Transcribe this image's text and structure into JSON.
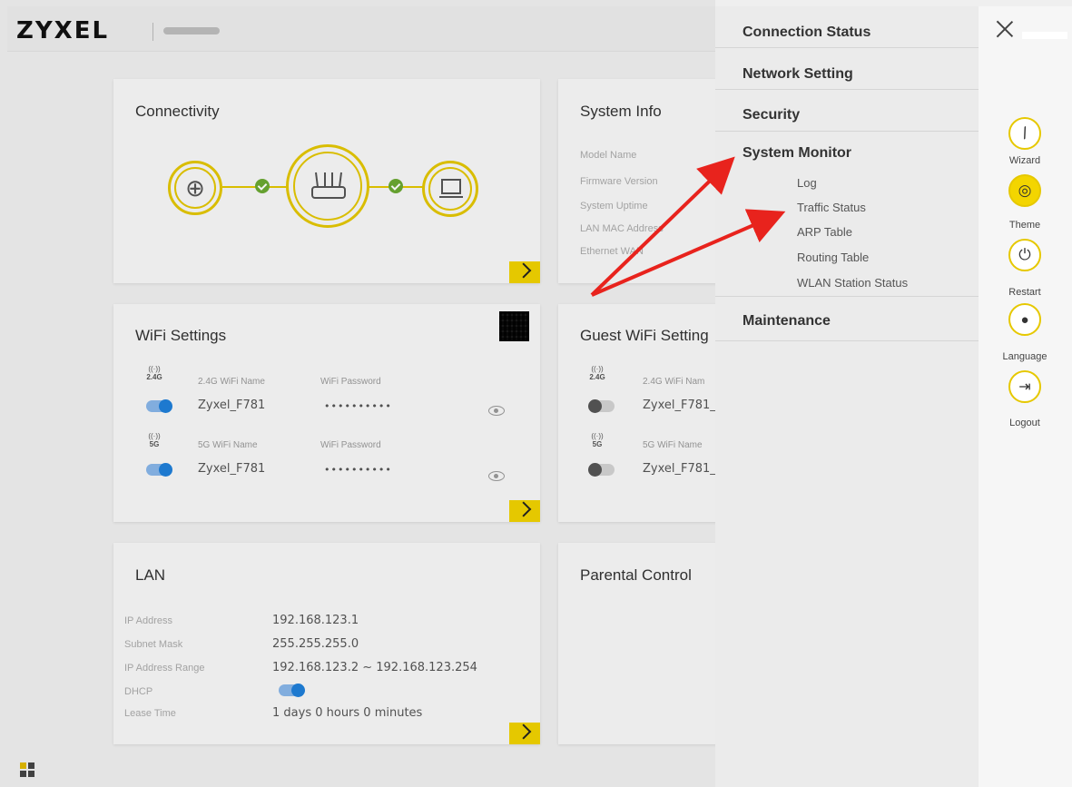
{
  "header": {
    "logo": "ZYXEL"
  },
  "connectivity": {
    "title": "Connectivity",
    "icons": [
      "globe-icon",
      "router-icon",
      "laptop-icon"
    ]
  },
  "system_info": {
    "title": "System Info",
    "labels": [
      "Model Name",
      "Firmware Version",
      "System Uptime",
      "LAN MAC Address",
      "Ethernet WAN"
    ]
  },
  "wifi_settings": {
    "title": "WiFi Settings",
    "rows": [
      {
        "band": "2.4G",
        "name_label": "2.4G WiFi Name",
        "name": "Zyxel_F781",
        "password_label": "WiFi Password",
        "password": "••••••••••",
        "enabled": true
      },
      {
        "band": "5G",
        "name_label": "5G WiFi Name",
        "name": "Zyxel_F781",
        "password_label": "WiFi Password",
        "password": "••••••••••",
        "enabled": true
      }
    ]
  },
  "guest_wifi": {
    "title": "Guest WiFi Setting",
    "rows": [
      {
        "band": "2.4G",
        "name_label": "2.4G WiFi Nam",
        "name": "Zyxel_F781_",
        "enabled": false
      },
      {
        "band": "5G",
        "name_label": "5G WiFi Name",
        "name": "Zyxel_F781_",
        "enabled": false
      }
    ]
  },
  "lan": {
    "title": "LAN",
    "rows": [
      {
        "label": "IP Address",
        "value": "192.168.123.1"
      },
      {
        "label": "Subnet Mask",
        "value": "255.255.255.0"
      },
      {
        "label": "IP Address Range",
        "value": "192.168.123.2 ~ 192.168.123.254"
      },
      {
        "label": "DHCP",
        "value": ""
      },
      {
        "label": "Lease Time",
        "value": "1 days 0 hours 0 minutes"
      }
    ],
    "dhcp_enabled": true
  },
  "parental_control": {
    "title": "Parental Control"
  },
  "menu": {
    "items": [
      {
        "label": "Connection Status"
      },
      {
        "label": "Network Setting"
      },
      {
        "label": "Security"
      },
      {
        "label": "System Monitor",
        "expanded": true,
        "children": [
          "Log",
          "Traffic Status",
          "ARP Table",
          "Routing Table",
          "WLAN Station Status"
        ]
      },
      {
        "label": "Maintenance"
      }
    ]
  },
  "rail": {
    "buttons": [
      {
        "label": "Wizard",
        "icon": "wand-icon",
        "active": false
      },
      {
        "label": "Theme",
        "icon": "palette-icon",
        "active": true
      },
      {
        "label": "Restart",
        "icon": "power-icon",
        "active": false
      },
      {
        "label": "Language",
        "icon": "globe-icon",
        "active": false
      },
      {
        "label": "Logout",
        "icon": "logout-icon",
        "active": false
      }
    ]
  },
  "colors": {
    "accent": "#f0d100",
    "toggle_on": "#1f7fd9",
    "annotation_arrow": "#e8231d",
    "status_ok": "#6aa832"
  }
}
